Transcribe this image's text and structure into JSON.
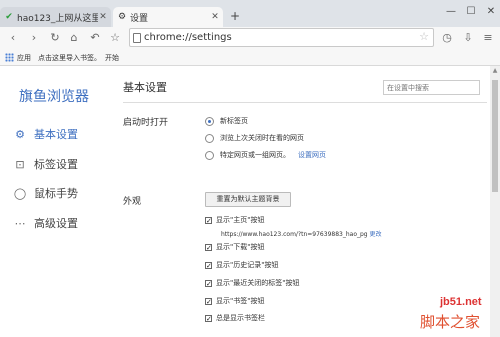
{
  "tabs": [
    {
      "title": "hao123_上网从这里开始",
      "active": false
    },
    {
      "title": "设置",
      "active": true
    }
  ],
  "new_tab_label": "+",
  "window_controls": {
    "minimize": "—",
    "maximize": "☐",
    "close": "✕"
  },
  "toolbar": {
    "url": "chrome://settings"
  },
  "bookmarks": {
    "apps_label": "应用",
    "import_label": "点击这里导入书签。",
    "start_label": "开始"
  },
  "sidebar": {
    "brand": "旗鱼浏览器",
    "items": [
      {
        "label": "基本设置",
        "icon": "gear-icon",
        "active": true
      },
      {
        "label": "标签设置",
        "icon": "tab-icon",
        "active": false
      },
      {
        "label": "鼠标手势",
        "icon": "mouse-icon",
        "active": false
      },
      {
        "label": "高级设置",
        "icon": "more-icon",
        "active": false
      }
    ]
  },
  "main": {
    "title": "基本设置",
    "search_placeholder": "在设置中搜索",
    "startup": {
      "label": "启动时打开",
      "options": [
        {
          "label": "新标签页",
          "selected": true
        },
        {
          "label": "浏览上次关闭时在看的网页",
          "selected": false
        },
        {
          "label": "特定网页或一组网页。",
          "selected": false,
          "link": "设置网页"
        }
      ]
    },
    "appearance": {
      "label": "外观",
      "reset_button": "重置为默认主题背景",
      "checkboxes": [
        {
          "label": "显示\"主页\"按钮",
          "checked": true
        },
        {
          "label": "显示\"下载\"按钮",
          "checked": true
        },
        {
          "label": "显示\"历史记录\"按钮",
          "checked": true
        },
        {
          "label": "显示\"最近关闭的标签\"按钮",
          "checked": true
        },
        {
          "label": "显示\"书签\"按钮",
          "checked": true
        },
        {
          "label": "总是显示书签栏",
          "checked": true
        }
      ],
      "home_url": "https://www.hao123.com/?tn=97639883_hao_pg",
      "home_change_link": "更改"
    }
  },
  "watermark": {
    "line1": "jb51.net",
    "line2": "脚本之家"
  },
  "colors": {
    "accent": "#3e6fc0",
    "tabstrip": "#dfe3e8"
  }
}
